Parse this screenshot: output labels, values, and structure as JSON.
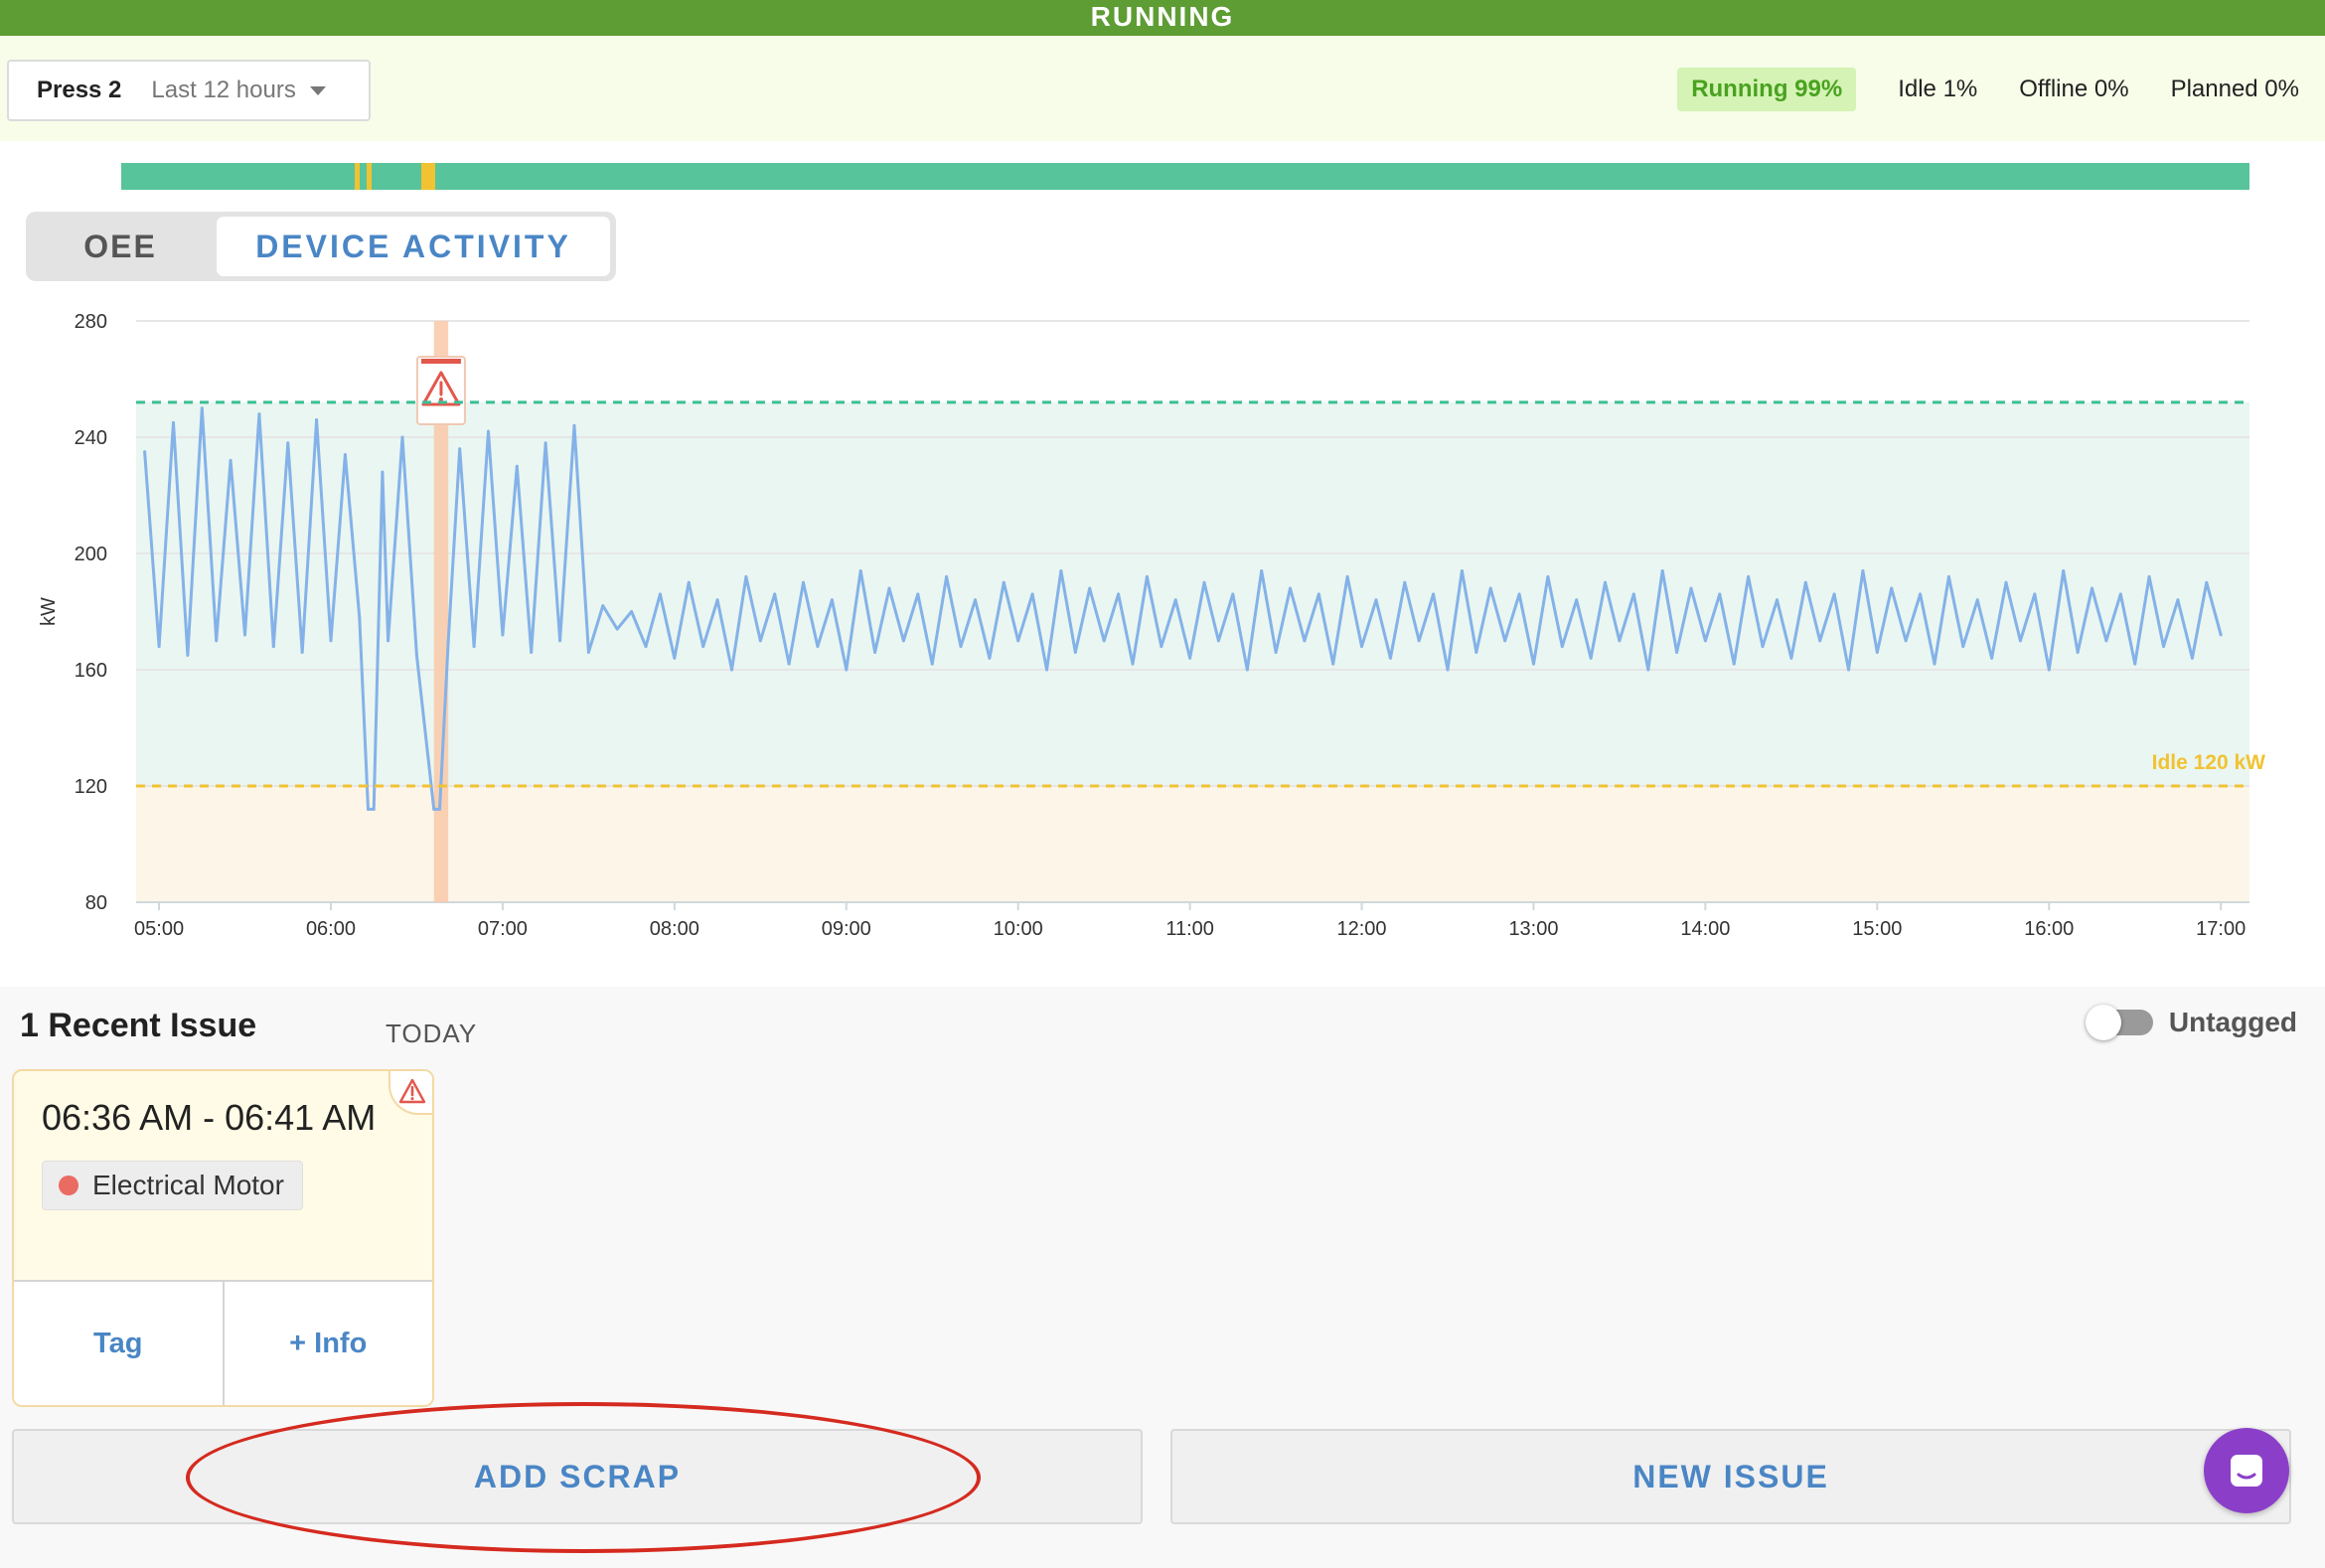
{
  "status": {
    "label": "RUNNING",
    "color": "#5e9c34"
  },
  "header": {
    "device": "Press 2",
    "time_range": "Last 12 hours",
    "stats": {
      "running": "Running 99%",
      "idle": "Idle 1%",
      "offline": "Offline 0%",
      "planned": "Planned 0%"
    }
  },
  "timeline": {
    "colors": {
      "running": "#58c49c",
      "idle": "#f1c232"
    },
    "idle_segments": [
      {
        "start": "06:13",
        "end": "06:14"
      },
      {
        "start": "06:17",
        "end": "06:18"
      },
      {
        "start": "06:36",
        "end": "06:41"
      }
    ]
  },
  "view_toggle": {
    "oee": "OEE",
    "device_activity": "DEVICE ACTIVITY",
    "active": "device_activity"
  },
  "chart_data": {
    "type": "line",
    "ylabel": "kW",
    "ylim": [
      80,
      280
    ],
    "yticks": [
      "80",
      "120",
      "160",
      "200",
      "240",
      "280"
    ],
    "xlim": [
      "04:52",
      "17:10"
    ],
    "xticks": [
      "05:00",
      "06:00",
      "07:00",
      "08:00",
      "09:00",
      "10:00",
      "11:00",
      "12:00",
      "13:00",
      "14:00",
      "15:00",
      "16:00",
      "17:00"
    ],
    "grid": true,
    "series": [
      {
        "color": "#84b2e8",
        "x": [
          "04:55",
          "05:00",
          "05:05",
          "05:10",
          "05:15",
          "05:20",
          "05:25",
          "05:30",
          "05:35",
          "05:40",
          "05:45",
          "05:50",
          "05:55",
          "06:00",
          "06:05",
          "06:10",
          "06:13",
          "06:15",
          "06:18",
          "06:20",
          "06:25",
          "06:30",
          "06:36",
          "06:38",
          "06:41",
          "06:45",
          "06:50",
          "06:55",
          "07:00",
          "07:05",
          "07:10",
          "07:15",
          "07:20",
          "07:25",
          "07:30",
          "07:35",
          "07:40",
          "07:45",
          "07:50",
          "07:55",
          "08:00",
          "08:05",
          "08:10",
          "08:15",
          "08:20",
          "08:25",
          "08:30",
          "08:35",
          "08:40",
          "08:45",
          "08:50",
          "08:55",
          "09:00",
          "09:05",
          "09:10",
          "09:15",
          "09:20",
          "09:25",
          "09:30",
          "09:35",
          "09:40",
          "09:45",
          "09:50",
          "09:55",
          "10:00",
          "10:05",
          "10:10",
          "10:15",
          "10:20",
          "10:25",
          "10:30",
          "10:35",
          "10:40",
          "10:45",
          "10:50",
          "10:55",
          "11:00",
          "11:05",
          "11:10",
          "11:15",
          "11:20",
          "11:25",
          "11:30",
          "11:35",
          "11:40",
          "11:45",
          "11:50",
          "11:55",
          "12:00",
          "12:05",
          "12:10",
          "12:15",
          "12:20",
          "12:25",
          "12:30",
          "12:35",
          "12:40",
          "12:45",
          "12:50",
          "12:55",
          "13:00",
          "13:05",
          "13:10",
          "13:15",
          "13:20",
          "13:25",
          "13:30",
          "13:35",
          "13:40",
          "13:45",
          "13:50",
          "13:55",
          "14:00",
          "14:05",
          "14:10",
          "14:15",
          "14:20",
          "14:25",
          "14:30",
          "14:35",
          "14:40",
          "14:45",
          "14:50",
          "14:55",
          "15:00",
          "15:05",
          "15:10",
          "15:15",
          "15:20",
          "15:25",
          "15:30",
          "15:35",
          "15:40",
          "15:45",
          "15:50",
          "15:55",
          "16:00",
          "16:05",
          "16:10",
          "16:15",
          "16:20",
          "16:25",
          "16:30",
          "16:35",
          "16:40",
          "16:45",
          "16:50",
          "16:55",
          "17:00"
        ],
        "y": [
          235,
          168,
          245,
          165,
          250,
          170,
          232,
          172,
          248,
          168,
          238,
          166,
          246,
          170,
          234,
          178,
          112,
          112,
          228,
          170,
          240,
          165,
          112,
          112,
          170,
          236,
          168,
          242,
          172,
          230,
          166,
          238,
          170,
          244,
          166,
          182,
          174,
          180,
          168,
          186,
          164,
          190,
          168,
          184,
          160,
          192,
          170,
          186,
          162,
          190,
          168,
          184,
          160,
          194,
          166,
          188,
          170,
          186,
          162,
          192,
          168,
          184,
          164,
          190,
          170,
          186,
          160,
          194,
          166,
          188,
          170,
          186,
          162,
          192,
          168,
          184,
          164,
          190,
          170,
          186,
          160,
          194,
          166,
          188,
          170,
          186,
          162,
          192,
          168,
          184,
          164,
          190,
          170,
          186,
          160,
          194,
          166,
          188,
          170,
          186,
          162,
          192,
          168,
          184,
          164,
          190,
          170,
          186,
          160,
          194,
          166,
          188,
          170,
          186,
          162,
          192,
          168,
          184,
          164,
          190,
          170,
          186,
          160,
          194,
          166,
          188,
          170,
          186,
          162,
          192,
          168,
          184,
          164,
          190,
          170,
          186,
          160,
          194,
          166,
          188,
          170,
          186,
          162,
          192,
          168,
          184,
          164,
          190,
          172
        ]
      }
    ],
    "thresholds": [
      {
        "value": 252,
        "color": "#3bbf96",
        "style": "dashed"
      },
      {
        "value": 120,
        "label": "Idle 120 kW",
        "color": "#f1c232",
        "style": "dashed"
      }
    ],
    "bands": [
      {
        "from": 120,
        "to": 252,
        "color": "#eaf6f1"
      },
      {
        "from": 80,
        "to": 120,
        "color": "#fdf6e8"
      }
    ],
    "event_markers": [
      {
        "start": "06:36",
        "end": "06:41",
        "icon": "warning-icon",
        "color": "#f9c9a8"
      }
    ]
  },
  "issues": {
    "title": "1 Recent Issue",
    "period": "TODAY",
    "toggle_label": "Untagged",
    "toggle_on": false,
    "items": [
      {
        "time": "06:36 AM - 06:41 AM",
        "tag": "Electrical Motor",
        "tag_color": "#ea6b62",
        "actions": {
          "tag": "Tag",
          "info": "+ Info"
        }
      }
    ]
  },
  "buttons": {
    "add_scrap": "ADD SCRAP",
    "new_issue": "NEW ISSUE"
  },
  "colors": {
    "accent": "#4a86c5",
    "highlight": "#d52a1f",
    "chat": "#8b3fc9"
  }
}
